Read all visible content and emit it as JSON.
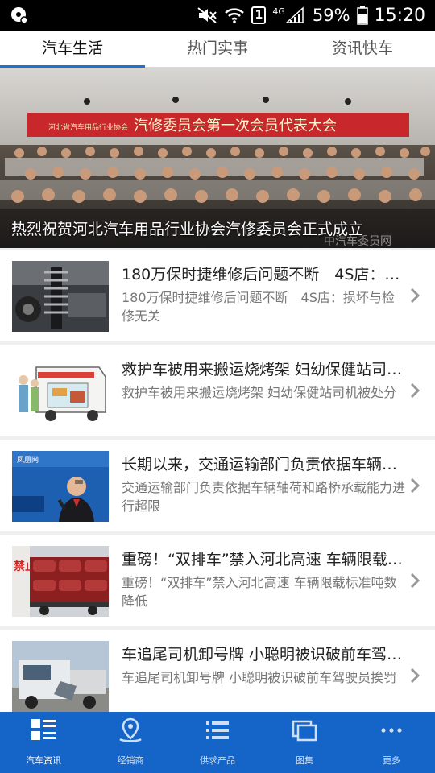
{
  "status_bar": {
    "battery_percent": "59%",
    "time": "15:20",
    "network": "4G",
    "sim": "1"
  },
  "tabs": [
    {
      "label": "汽车生活",
      "active": true
    },
    {
      "label": "热门实事",
      "active": false
    },
    {
      "label": "资讯快车",
      "active": false
    }
  ],
  "banner": {
    "caption": "热烈祝贺河北汽车用品行业协会汽修委员会正式成立",
    "sign_text": "汽修委员会第一次会员代表大会",
    "sign_small": "河北省汽车用品行业协会",
    "watermark": "中汽车委员网"
  },
  "news": [
    {
      "title": "180万保时捷维修后问题不断　4S店：损坏与检修无关",
      "summary": "180万保时捷维修后问题不断　4S店：损坏与检修无关",
      "thumb_icon": "car-suspension-photo"
    },
    {
      "title": "救护车被用来搬运烧烤架 妇幼保健站司机被处分",
      "summary": "救护车被用来搬运烧烤架 妇幼保健站司机被处分",
      "thumb_icon": "ambulance-illustration"
    },
    {
      "title": "长期以来，交通运输部门负责依据车辆轴荷和路桥承载能力进行超限",
      "summary": "交通运输部门负责依据车辆轴荷和路桥承载能力进行超限",
      "thumb_icon": "speaker-at-event-photo",
      "thumb_text": "凤凰网"
    },
    {
      "title": "重磅！“双排车”禁入河北高速 车辆限载标准吨数降低",
      "summary": "重磅！“双排车”禁入河北高速 车辆限载标准吨数降低",
      "thumb_icon": "car-carrier-truck-photo",
      "thumb_text": "禁止"
    },
    {
      "title": "车追尾司机卸号牌 小聪明被识破前车驾驶员挨罚",
      "summary": "车追尾司机卸号牌 小聪明被识破前车驾驶员挨罚",
      "thumb_icon": "crashed-truck-photo"
    }
  ],
  "bottom_nav": [
    {
      "label": "汽车资讯",
      "icon": "news-grid-icon",
      "active": true
    },
    {
      "label": "经销商",
      "icon": "location-pin-icon",
      "active": false
    },
    {
      "label": "供求产品",
      "icon": "list-icon",
      "active": false
    },
    {
      "label": "图集",
      "icon": "gallery-icon",
      "active": false
    },
    {
      "label": "更多",
      "icon": "more-dots-icon",
      "active": false
    }
  ],
  "colors": {
    "accent": "#1a73d8",
    "nav_bg": "#1565c8"
  }
}
